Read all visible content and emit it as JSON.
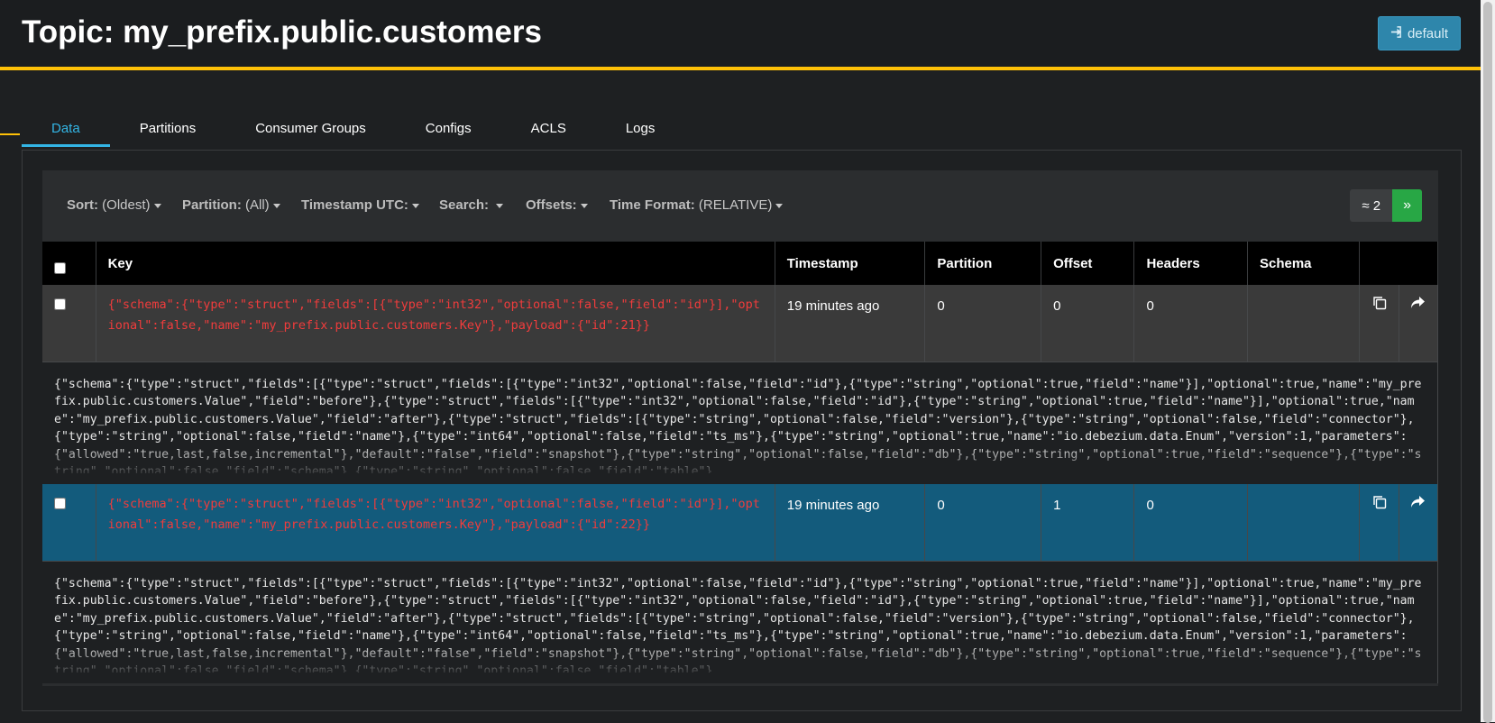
{
  "page": {
    "title": "Topic: my_prefix.public.customers",
    "user_button": "default"
  },
  "tabs": [
    {
      "label": "Data",
      "active": true
    },
    {
      "label": "Partitions"
    },
    {
      "label": "Consumer Groups"
    },
    {
      "label": "Configs"
    },
    {
      "label": "ACLS"
    },
    {
      "label": "Logs"
    }
  ],
  "filters": {
    "sort_label": "Sort:",
    "sort_value": "(Oldest)",
    "partition_label": "Partition:",
    "partition_value": "(All)",
    "timestamp_label": "Timestamp UTC:",
    "search_label": "Search:",
    "offsets_label": "Offsets:",
    "time_format_label": "Time Format:",
    "time_format_value": "(RELATIVE)"
  },
  "pager": {
    "count": "≈ 2",
    "next": "»"
  },
  "columns": [
    "Key",
    "Timestamp",
    "Partition",
    "Offset",
    "Headers",
    "Schema"
  ],
  "rows": [
    {
      "key": "{\"schema\":{\"type\":\"struct\",\"fields\":[{\"type\":\"int32\",\"optional\":false,\"field\":\"id\"}],\"optional\":false,\"name\":\"my_prefix.public.customers.Key\"},\"payload\":{\"id\":21}}",
      "timestamp": "19 minutes ago",
      "partition": "0",
      "offset": "0",
      "headers": "0",
      "schema": "",
      "value": "{\"schema\":{\"type\":\"struct\",\"fields\":[{\"type\":\"struct\",\"fields\":[{\"type\":\"int32\",\"optional\":false,\"field\":\"id\"},{\"type\":\"string\",\"optional\":true,\"field\":\"name\"}],\"optional\":true,\"name\":\"my_prefix.public.customers.Value\",\"field\":\"before\"},{\"type\":\"struct\",\"fields\":[{\"type\":\"int32\",\"optional\":false,\"field\":\"id\"},{\"type\":\"string\",\"optional\":true,\"field\":\"name\"}],\"optional\":true,\"name\":\"my_prefix.public.customers.Value\",\"field\":\"after\"},{\"type\":\"struct\",\"fields\":[{\"type\":\"string\",\"optional\":false,\"field\":\"version\"},{\"type\":\"string\",\"optional\":false,\"field\":\"connector\"},{\"type\":\"string\",\"optional\":false,\"field\":\"name\"},{\"type\":\"int64\",\"optional\":false,\"field\":\"ts_ms\"},{\"type\":\"string\",\"optional\":true,\"name\":\"io.debezium.data.Enum\",\"version\":1,\"parameters\":{\"allowed\":\"true,last,false,incremental\"},\"default\":\"false\",\"field\":\"snapshot\"},{\"type\":\"string\",\"optional\":false,\"field\":\"db\"},{\"type\":\"string\",\"optional\":true,\"field\":\"sequence\"},{\"type\":\"string\",\"optional\":false,\"field\":\"schema\"},{\"type\":\"string\",\"optional\":false,\"field\":\"table\"}"
    },
    {
      "key": "{\"schema\":{\"type\":\"struct\",\"fields\":[{\"type\":\"int32\",\"optional\":false,\"field\":\"id\"}],\"optional\":false,\"name\":\"my_prefix.public.customers.Key\"},\"payload\":{\"id\":22}}",
      "timestamp": "19 minutes ago",
      "partition": "0",
      "offset": "1",
      "headers": "0",
      "schema": "",
      "value": "{\"schema\":{\"type\":\"struct\",\"fields\":[{\"type\":\"struct\",\"fields\":[{\"type\":\"int32\",\"optional\":false,\"field\":\"id\"},{\"type\":\"string\",\"optional\":true,\"field\":\"name\"}],\"optional\":true,\"name\":\"my_prefix.public.customers.Value\",\"field\":\"before\"},{\"type\":\"struct\",\"fields\":[{\"type\":\"int32\",\"optional\":false,\"field\":\"id\"},{\"type\":\"string\",\"optional\":true,\"field\":\"name\"}],\"optional\":true,\"name\":\"my_prefix.public.customers.Value\",\"field\":\"after\"},{\"type\":\"struct\",\"fields\":[{\"type\":\"string\",\"optional\":false,\"field\":\"version\"},{\"type\":\"string\",\"optional\":false,\"field\":\"connector\"},{\"type\":\"string\",\"optional\":false,\"field\":\"name\"},{\"type\":\"int64\",\"optional\":false,\"field\":\"ts_ms\"},{\"type\":\"string\",\"optional\":true,\"name\":\"io.debezium.data.Enum\",\"version\":1,\"parameters\":{\"allowed\":\"true,last,false,incremental\"},\"default\":\"false\",\"field\":\"snapshot\"},{\"type\":\"string\",\"optional\":false,\"field\":\"db\"},{\"type\":\"string\",\"optional\":true,\"field\":\"sequence\"},{\"type\":\"string\",\"optional\":false,\"field\":\"schema\"},{\"type\":\"string\",\"optional\":false,\"field\":\"table\"}"
    }
  ],
  "colors": {
    "accent_yellow": "#ffc107",
    "tab_active": "#33b5e5",
    "selected_row": "#135b7c",
    "key_text": "#f03c3c",
    "next_button": "#28a745",
    "user_button": "#2e86ab"
  },
  "icons": {
    "user_button_icon": "sign-in-icon",
    "copy": "copy-icon",
    "share": "share-icon"
  }
}
